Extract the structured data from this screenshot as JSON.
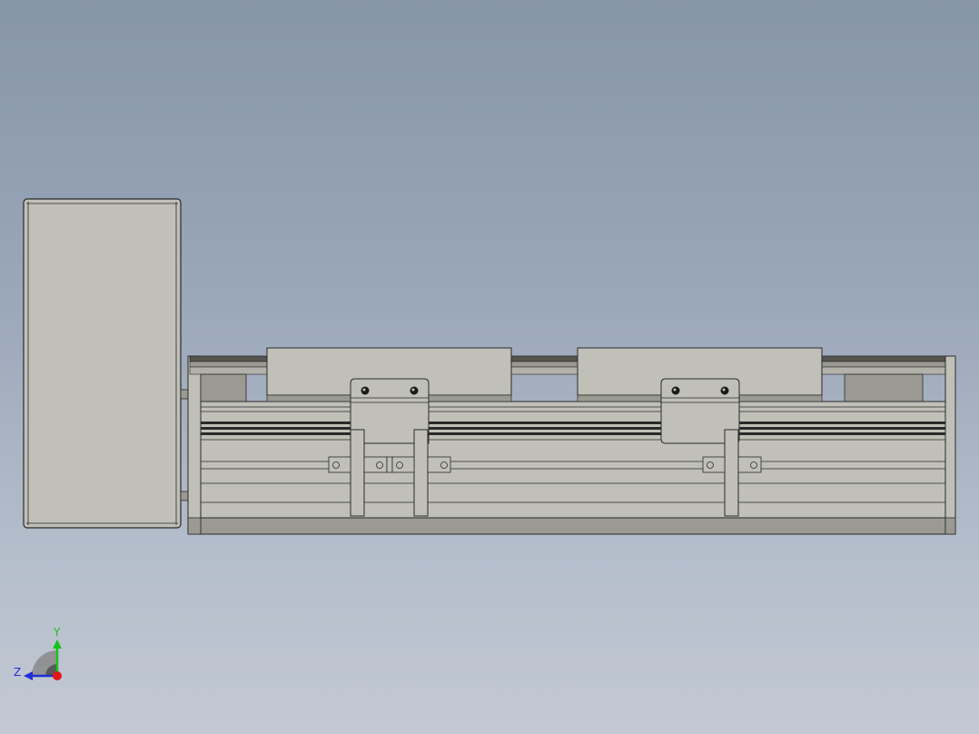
{
  "viewport": {
    "background_top": "#8795a9",
    "background_bottom": "#c3c9d4"
  },
  "model": {
    "body_color": "#c0c0b8",
    "shadow_color": "#9b9a92",
    "dark_strip_color": "#55554f",
    "edge_color": "#2a2a2a",
    "hole_color": "#1a1a1a"
  },
  "triad": {
    "y_label": "Y",
    "z_label": "Z",
    "x_color": "#e01818",
    "y_color": "#17c217",
    "z_color": "#1f2fd6"
  }
}
